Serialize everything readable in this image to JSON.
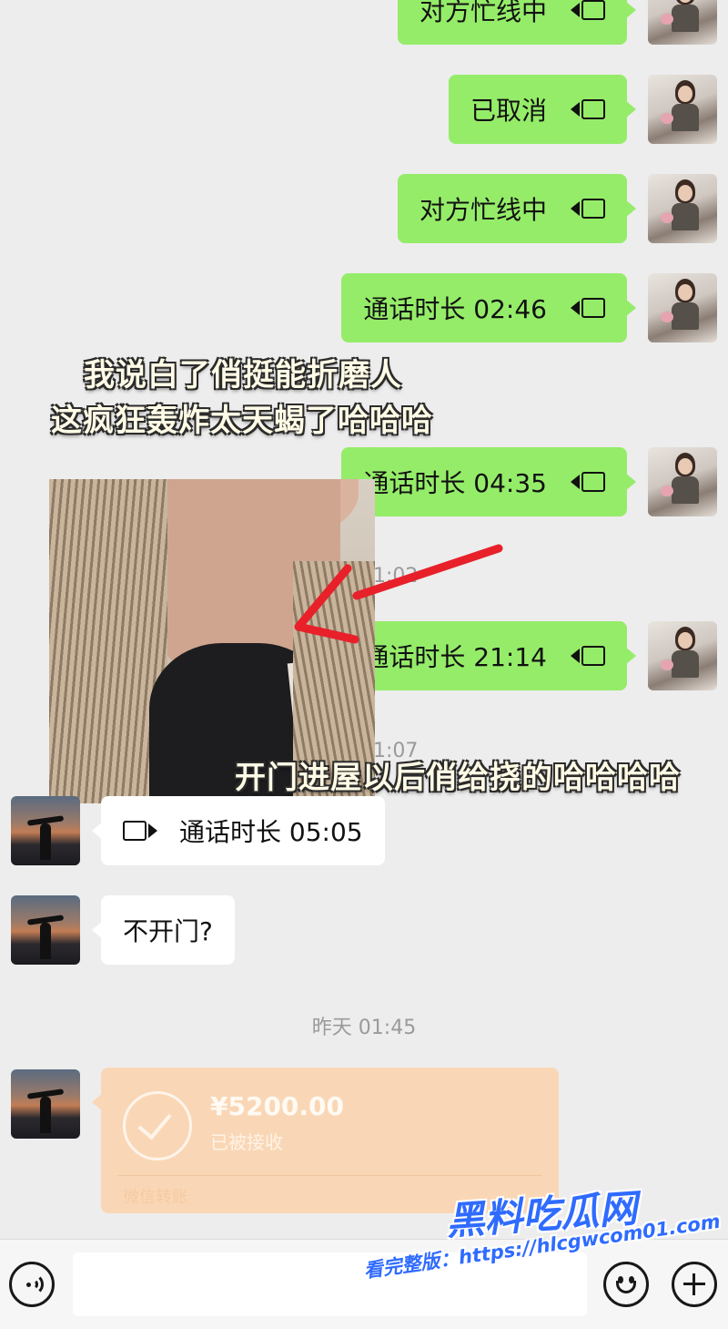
{
  "messages_outgoing": [
    {
      "text": "对方忙线中"
    },
    {
      "text": "已取消"
    },
    {
      "text": "对方忙线中"
    },
    {
      "text": "通话时长 02:46"
    },
    {
      "text": "通话时长 04:35"
    },
    {
      "text": "通话时长 21:14"
    }
  ],
  "messages_incoming": [
    {
      "text": "通话时长 05:05"
    },
    {
      "text": "不开门?"
    }
  ],
  "timestamps": {
    "partial_1": "1:02",
    "partial_2": "1:07",
    "full": "昨天 01:45"
  },
  "captions": {
    "line1": "我说白了俏挺能折磨人",
    "line2": "这疯狂轰炸太天蝎了哈哈哈",
    "line3": "开门进屋以后俏给挠的哈哈哈哈"
  },
  "transfer": {
    "amount": "¥5200.00",
    "status": "已被接收",
    "source": "微信转账"
  },
  "watermark": {
    "logo": "黑料吃瓜网",
    "url": "看完整版：https://hlcgwcom01.com"
  },
  "icons": {
    "voice": "voice-icon",
    "emoji": "emoji-icon",
    "plus": "plus-icon",
    "video_call": "video-call-icon"
  },
  "colors": {
    "outgoing_bubble": "#95ec69",
    "incoming_bubble": "#ffffff",
    "transfer_bubble": "#f9d7b6",
    "background": "#ededed",
    "arrow": "#e8202a",
    "watermark": "#2f6bff"
  }
}
